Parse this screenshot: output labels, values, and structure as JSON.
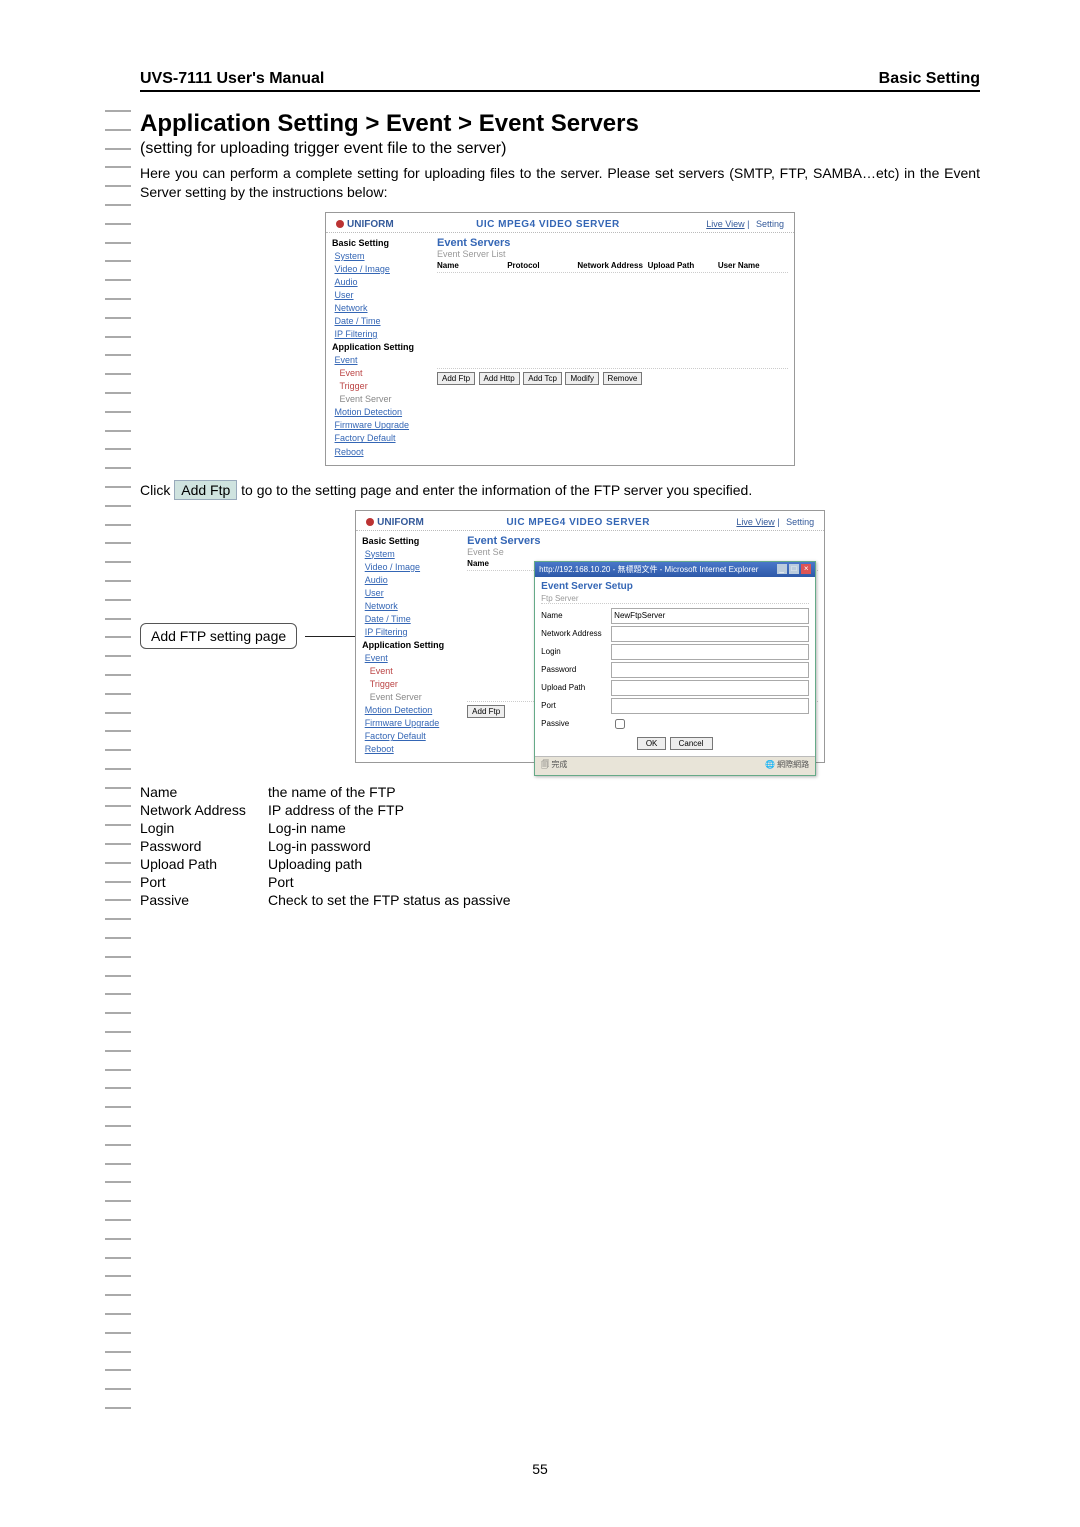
{
  "header": {
    "left": "UVS-7111 User's Manual",
    "right": "Basic Setting"
  },
  "title": "Application Setting > Event > Event Servers",
  "subtitle": "(setting for uploading trigger event file to the server)",
  "intro": "Here you can perform a complete setting for uploading files to the server. Please set servers (SMTP, FTP, SAMBA…etc) in the Event Server setting by the instructions below:",
  "screenshot1": {
    "logo": "UNIFORM",
    "center": "UIC MPEG4 VIDEO SERVER",
    "live_view": "Live View",
    "setting": "Setting",
    "sidebar": {
      "basic_setting": "Basic Setting",
      "system": "System",
      "video_image": "Video / Image",
      "audio": "Audio",
      "user": "User",
      "network": "Network",
      "date_time": "Date / Time",
      "ip_filtering": "IP Filtering",
      "app_setting": "Application Setting",
      "event": "Event",
      "event_sub": "Event",
      "trigger": "Trigger",
      "event_server": "Event Server",
      "motion_detection": "Motion Detection",
      "firmware_upgrade": "Firmware Upgrade",
      "factory_default": "Factory Default",
      "reboot": "Reboot"
    },
    "panel": {
      "title": "Event Servers",
      "list_title": "Event Server List",
      "cols": {
        "name": "Name",
        "protocol": "Protocol",
        "network_address": "Network Address",
        "upload_path": "Upload Path",
        "user_name": "User Name"
      },
      "buttons": {
        "add_ftp": "Add Ftp",
        "add_http": "Add Http",
        "add_tcp": "Add Tcp",
        "modify": "Modify",
        "remove": "Remove"
      }
    }
  },
  "click_text": {
    "pre": "Click ",
    "btn": "Add Ftp",
    "post": " to go to the setting page and enter the information of the FTP server you specified."
  },
  "callout": "Add FTP setting page",
  "screenshot2": {
    "addftp_btn": "Add Ftp",
    "popup": {
      "titlebar": "http://192.168.10.20 - 無標題文件 - Microsoft Internet Explorer",
      "heading": "Event Server Setup",
      "subheading": "Ftp Server",
      "fields": {
        "name_label": "Name",
        "name_value": "NewFtpServer",
        "network_address": "Network Address",
        "login": "Login",
        "password": "Password",
        "upload_path": "Upload Path",
        "port": "Port",
        "passive": "Passive"
      },
      "ok": "OK",
      "cancel": "Cancel",
      "status_left": "完成",
      "status_right": "網際網路"
    }
  },
  "definitions": [
    {
      "term": "Name",
      "desc": "the name of the FTP"
    },
    {
      "term": "Network Address",
      "desc": "IP address of the FTP"
    },
    {
      "term": "Login",
      "desc": "Log-in name"
    },
    {
      "term": "Password",
      "desc": "Log-in password"
    },
    {
      "term": "Upload Path",
      "desc": "Uploading path"
    },
    {
      "term": "Port",
      "desc": "Port"
    },
    {
      "term": "Passive",
      "desc": "Check to set the FTP status as passive"
    }
  ],
  "page_number": "55"
}
